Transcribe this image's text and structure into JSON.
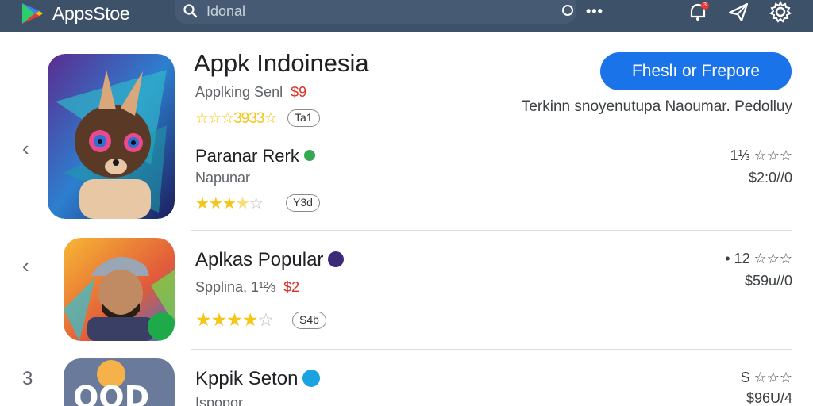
{
  "topbar": {
    "app_name": "AppsStoe",
    "search_text": "Idonal",
    "more_label": "•••",
    "notification_count": "3"
  },
  "featured": {
    "title": "Appk Indoinesia",
    "subtitle": "Applking Senl",
    "price": "$9",
    "rating_text": "☆☆☆3933☆",
    "pill": "Ta1",
    "cta_label": "Fheslı or Frepore",
    "promo_text": "Terkinn snoyenutupa Naoumar. Pedolluy"
  },
  "rows": [
    {
      "chevron": "‹",
      "title": "Paranar Rerk",
      "subtitle": "Napunar",
      "rating_value": 3.5,
      "pill": "Y3d",
      "meta_top": "1⅓ ☆☆☆",
      "meta_bottom": "$2:0//0"
    },
    {
      "chevron": "‹",
      "title": "Aplkas Popular",
      "subtitle": "Spplina, 1¹⅔",
      "price": "$2",
      "rating_value": 4,
      "pill": "S4b",
      "meta_top": "• 12 ☆☆☆",
      "meta_bottom": "$59u//0"
    },
    {
      "chevron": "3",
      "title": "Kppik Seton",
      "subtitle": "Ispopor",
      "meta_top": "S ☆☆☆",
      "meta_bottom": "$96U/4"
    }
  ],
  "colors": {
    "topbar": "#3d5168",
    "accent": "#1a73e8",
    "star": "#f5c518",
    "price": "#d93025"
  }
}
